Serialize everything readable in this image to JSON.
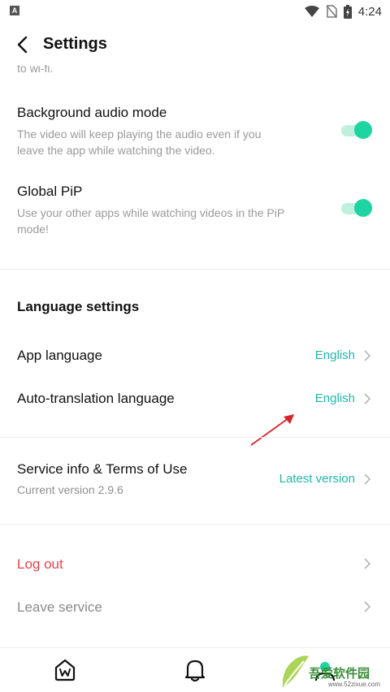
{
  "status_bar": {
    "notification_icon": "A",
    "icons": [
      "wifi-icon",
      "no-sim-icon",
      "battery-icon"
    ],
    "time": "4:24"
  },
  "header": {
    "back_icon": "back-arrow-icon",
    "title": "Settings"
  },
  "clipped_text": "to wi-fi.",
  "toggles": [
    {
      "title": "Background audio mode",
      "description_lines": [
        "The video will keep playing the audio even if you",
        "leave the app while watching the video."
      ],
      "enabled": true
    },
    {
      "title": "Global PiP",
      "description_lines": [
        "Use your other apps while watching videos in the PiP",
        "mode!"
      ],
      "enabled": true
    }
  ],
  "language_section": {
    "title": "Language settings",
    "rows": [
      {
        "label": "App language",
        "value": "English"
      },
      {
        "label": "Auto-translation language",
        "value": "English"
      }
    ]
  },
  "service_info": {
    "label": "Service info & Terms of Use",
    "version_text": "Current version 2.9.6",
    "value": "Latest version"
  },
  "account": {
    "logout_label": "Log out",
    "leave_label": "Leave service"
  },
  "bottom_nav": {
    "items": [
      "home-w-icon",
      "bell-icon",
      "profile-icon"
    ]
  },
  "watermark": {
    "text": "吾爱软件园",
    "url": "www.52zixue.com"
  },
  "colors": {
    "accent": "#1dd4a2",
    "link_value": "#1fb7a8",
    "danger": "#e8424a",
    "annotation_arrow": "#d9232a"
  }
}
